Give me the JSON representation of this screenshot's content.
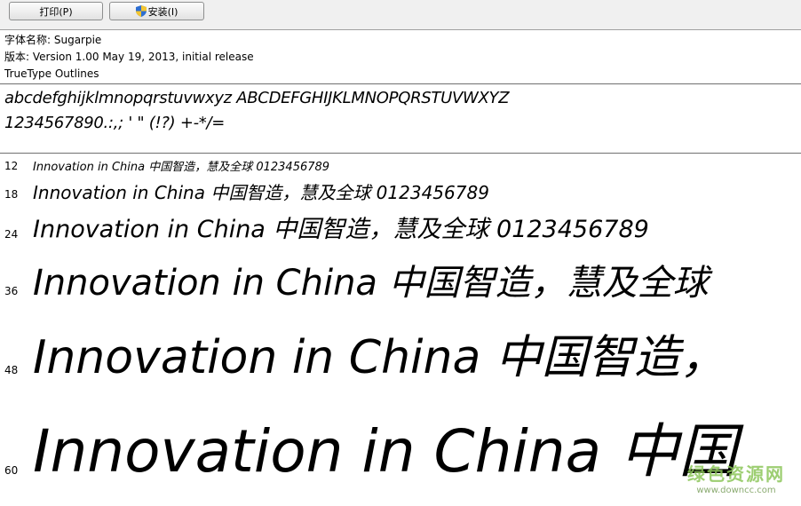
{
  "toolbar": {
    "print_label": "打印(P)",
    "install_label": "安装(I)"
  },
  "info": {
    "font_name": "字体名称: Sugarpie",
    "version": "版本: Version 1.00 May 19, 2013, initial release",
    "outline_type": "TrueType Outlines"
  },
  "charset": {
    "line1": "abcdefghijklmnopqrstuvwxyz ABCDEFGHIJKLMNOPQRSTUVWXYZ",
    "line2": "1234567890.:,; ' \" (!?) +-*/="
  },
  "samples": [
    {
      "size": "12",
      "text": "Innovation in China 中国智造，慧及全球 0123456789"
    },
    {
      "size": "18",
      "text": "Innovation in China 中国智造，慧及全球 0123456789"
    },
    {
      "size": "24",
      "text": "Innovation in China 中国智造，慧及全球 0123456789"
    },
    {
      "size": "36",
      "text": "Innovation in China 中国智造，慧及全球"
    },
    {
      "size": "48",
      "text": "Innovation in China 中国智造，"
    },
    {
      "size": "60",
      "text": "Innovation in China 中国"
    }
  ],
  "watermark": {
    "name": "绿色资源网",
    "url": "www.downcc.com"
  },
  "colors": {
    "toolbar_bg": "#f0f0f0",
    "shield_blue": "#2d6ed1",
    "shield_yellow": "#f3c531",
    "watermark_green": "#8cc65a"
  }
}
